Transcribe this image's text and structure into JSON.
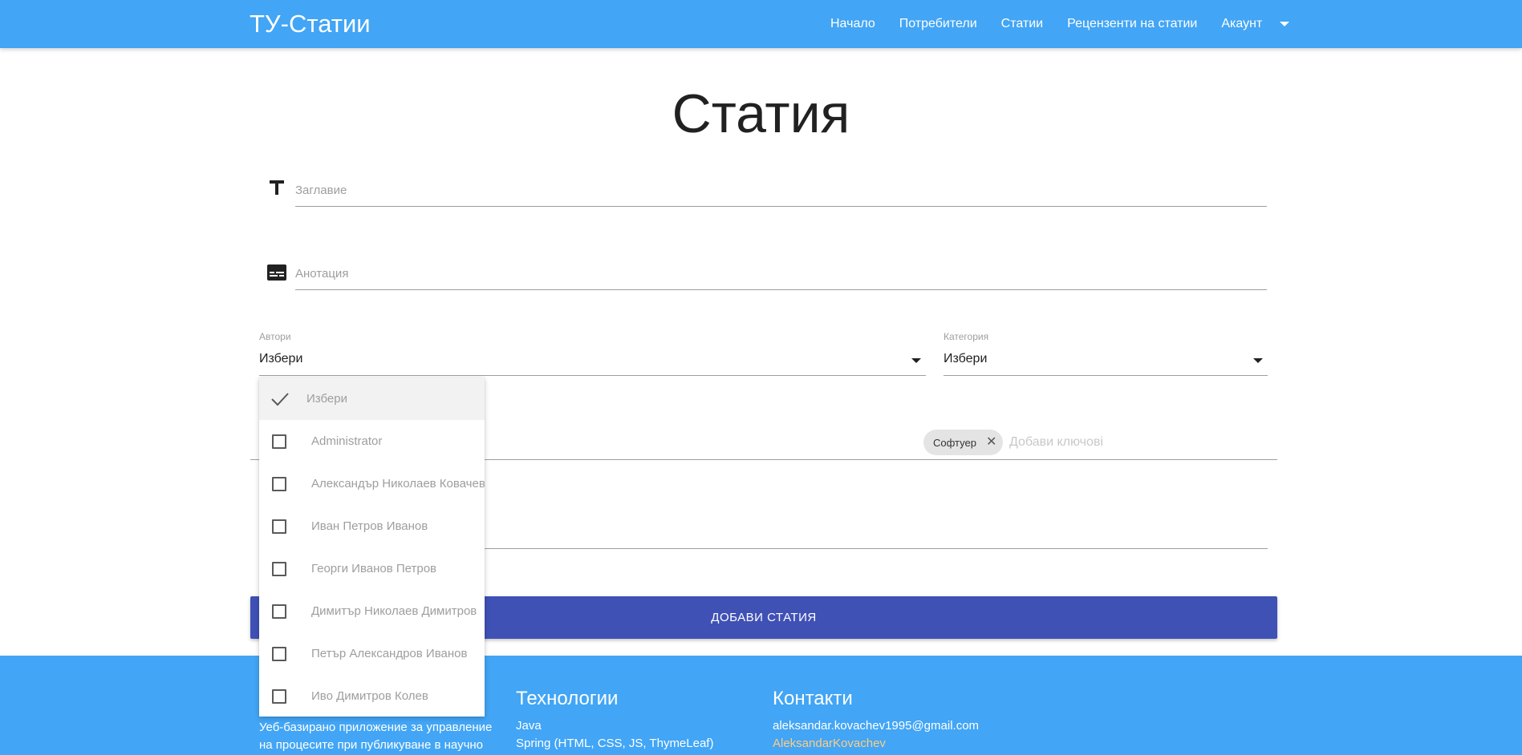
{
  "navbar": {
    "brand": "ТУ-Статии",
    "links": [
      "Начало",
      "Потребители",
      "Статии",
      "Рецензенти на статии",
      "Акаунт"
    ]
  },
  "page": {
    "title": "Статия"
  },
  "form": {
    "title_placeholder": "Заглавие",
    "annotation_placeholder": "Анотация",
    "authors_label": "Автори",
    "authors_value": "Избери",
    "category_label": "Категория",
    "category_value": "Избери",
    "keyword_chip": "Софтуер",
    "keywords_placeholder": "Добави ключові",
    "submit_label": "ДОБАВИ СТАТИЯ"
  },
  "authors_dropdown": {
    "items": [
      {
        "label": "Избери",
        "selected": true
      },
      {
        "label": "Administrator",
        "selected": false
      },
      {
        "label": "Александър Николаев Ковачев",
        "selected": false
      },
      {
        "label": "Иван Петров Иванов",
        "selected": false
      },
      {
        "label": "Георги Иванов Петров",
        "selected": false
      },
      {
        "label": "Димитър Николаев Димитров",
        "selected": false
      },
      {
        "label": "Петър Александров Иванов",
        "selected": false
      },
      {
        "label": "Иво Димитров Колев",
        "selected": false
      }
    ]
  },
  "footer": {
    "description": "Уеб-базирано приложение за управление на процесите при публикуване в научно",
    "tech_heading": "Технологии",
    "tech_items": [
      "Java",
      "Spring (HTML, CSS, JS, ThymeLeaf)"
    ],
    "contacts_heading": "Контакти",
    "contact_email": "aleksandar.kovachev1995@gmail.com",
    "contact_github": "AleksandarKovachev"
  },
  "colors": {
    "primary": "#42a5f5",
    "button": "#3f51b5",
    "link_accent": "#ffcc80"
  },
  "icons": {
    "title_field": "text-t-icon",
    "annotation_field": "subtitles-icon",
    "select_caret": "arrow-drop-down-icon",
    "chip_close": "close-icon",
    "selected_item": "checkmark-icon"
  }
}
